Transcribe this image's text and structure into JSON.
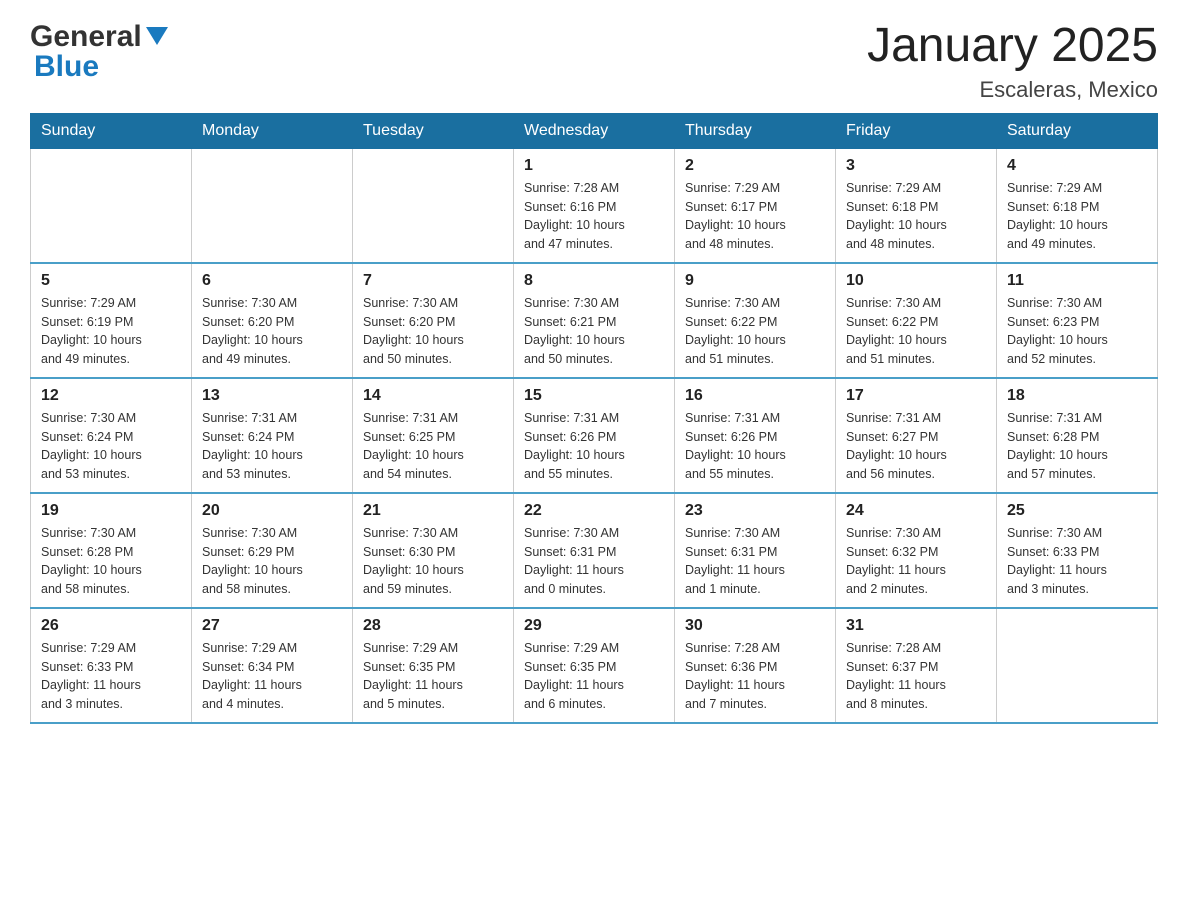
{
  "header": {
    "logo_general": "General",
    "logo_blue": "Blue",
    "title": "January 2025",
    "subtitle": "Escaleras, Mexico"
  },
  "days_of_week": [
    "Sunday",
    "Monday",
    "Tuesday",
    "Wednesday",
    "Thursday",
    "Friday",
    "Saturday"
  ],
  "weeks": [
    [
      {
        "day": "",
        "info": ""
      },
      {
        "day": "",
        "info": ""
      },
      {
        "day": "",
        "info": ""
      },
      {
        "day": "1",
        "info": "Sunrise: 7:28 AM\nSunset: 6:16 PM\nDaylight: 10 hours\nand 47 minutes."
      },
      {
        "day": "2",
        "info": "Sunrise: 7:29 AM\nSunset: 6:17 PM\nDaylight: 10 hours\nand 48 minutes."
      },
      {
        "day": "3",
        "info": "Sunrise: 7:29 AM\nSunset: 6:18 PM\nDaylight: 10 hours\nand 48 minutes."
      },
      {
        "day": "4",
        "info": "Sunrise: 7:29 AM\nSunset: 6:18 PM\nDaylight: 10 hours\nand 49 minutes."
      }
    ],
    [
      {
        "day": "5",
        "info": "Sunrise: 7:29 AM\nSunset: 6:19 PM\nDaylight: 10 hours\nand 49 minutes."
      },
      {
        "day": "6",
        "info": "Sunrise: 7:30 AM\nSunset: 6:20 PM\nDaylight: 10 hours\nand 49 minutes."
      },
      {
        "day": "7",
        "info": "Sunrise: 7:30 AM\nSunset: 6:20 PM\nDaylight: 10 hours\nand 50 minutes."
      },
      {
        "day": "8",
        "info": "Sunrise: 7:30 AM\nSunset: 6:21 PM\nDaylight: 10 hours\nand 50 minutes."
      },
      {
        "day": "9",
        "info": "Sunrise: 7:30 AM\nSunset: 6:22 PM\nDaylight: 10 hours\nand 51 minutes."
      },
      {
        "day": "10",
        "info": "Sunrise: 7:30 AM\nSunset: 6:22 PM\nDaylight: 10 hours\nand 51 minutes."
      },
      {
        "day": "11",
        "info": "Sunrise: 7:30 AM\nSunset: 6:23 PM\nDaylight: 10 hours\nand 52 minutes."
      }
    ],
    [
      {
        "day": "12",
        "info": "Sunrise: 7:30 AM\nSunset: 6:24 PM\nDaylight: 10 hours\nand 53 minutes."
      },
      {
        "day": "13",
        "info": "Sunrise: 7:31 AM\nSunset: 6:24 PM\nDaylight: 10 hours\nand 53 minutes."
      },
      {
        "day": "14",
        "info": "Sunrise: 7:31 AM\nSunset: 6:25 PM\nDaylight: 10 hours\nand 54 minutes."
      },
      {
        "day": "15",
        "info": "Sunrise: 7:31 AM\nSunset: 6:26 PM\nDaylight: 10 hours\nand 55 minutes."
      },
      {
        "day": "16",
        "info": "Sunrise: 7:31 AM\nSunset: 6:26 PM\nDaylight: 10 hours\nand 55 minutes."
      },
      {
        "day": "17",
        "info": "Sunrise: 7:31 AM\nSunset: 6:27 PM\nDaylight: 10 hours\nand 56 minutes."
      },
      {
        "day": "18",
        "info": "Sunrise: 7:31 AM\nSunset: 6:28 PM\nDaylight: 10 hours\nand 57 minutes."
      }
    ],
    [
      {
        "day": "19",
        "info": "Sunrise: 7:30 AM\nSunset: 6:28 PM\nDaylight: 10 hours\nand 58 minutes."
      },
      {
        "day": "20",
        "info": "Sunrise: 7:30 AM\nSunset: 6:29 PM\nDaylight: 10 hours\nand 58 minutes."
      },
      {
        "day": "21",
        "info": "Sunrise: 7:30 AM\nSunset: 6:30 PM\nDaylight: 10 hours\nand 59 minutes."
      },
      {
        "day": "22",
        "info": "Sunrise: 7:30 AM\nSunset: 6:31 PM\nDaylight: 11 hours\nand 0 minutes."
      },
      {
        "day": "23",
        "info": "Sunrise: 7:30 AM\nSunset: 6:31 PM\nDaylight: 11 hours\nand 1 minute."
      },
      {
        "day": "24",
        "info": "Sunrise: 7:30 AM\nSunset: 6:32 PM\nDaylight: 11 hours\nand 2 minutes."
      },
      {
        "day": "25",
        "info": "Sunrise: 7:30 AM\nSunset: 6:33 PM\nDaylight: 11 hours\nand 3 minutes."
      }
    ],
    [
      {
        "day": "26",
        "info": "Sunrise: 7:29 AM\nSunset: 6:33 PM\nDaylight: 11 hours\nand 3 minutes."
      },
      {
        "day": "27",
        "info": "Sunrise: 7:29 AM\nSunset: 6:34 PM\nDaylight: 11 hours\nand 4 minutes."
      },
      {
        "day": "28",
        "info": "Sunrise: 7:29 AM\nSunset: 6:35 PM\nDaylight: 11 hours\nand 5 minutes."
      },
      {
        "day": "29",
        "info": "Sunrise: 7:29 AM\nSunset: 6:35 PM\nDaylight: 11 hours\nand 6 minutes."
      },
      {
        "day": "30",
        "info": "Sunrise: 7:28 AM\nSunset: 6:36 PM\nDaylight: 11 hours\nand 7 minutes."
      },
      {
        "day": "31",
        "info": "Sunrise: 7:28 AM\nSunset: 6:37 PM\nDaylight: 11 hours\nand 8 minutes."
      },
      {
        "day": "",
        "info": ""
      }
    ]
  ]
}
